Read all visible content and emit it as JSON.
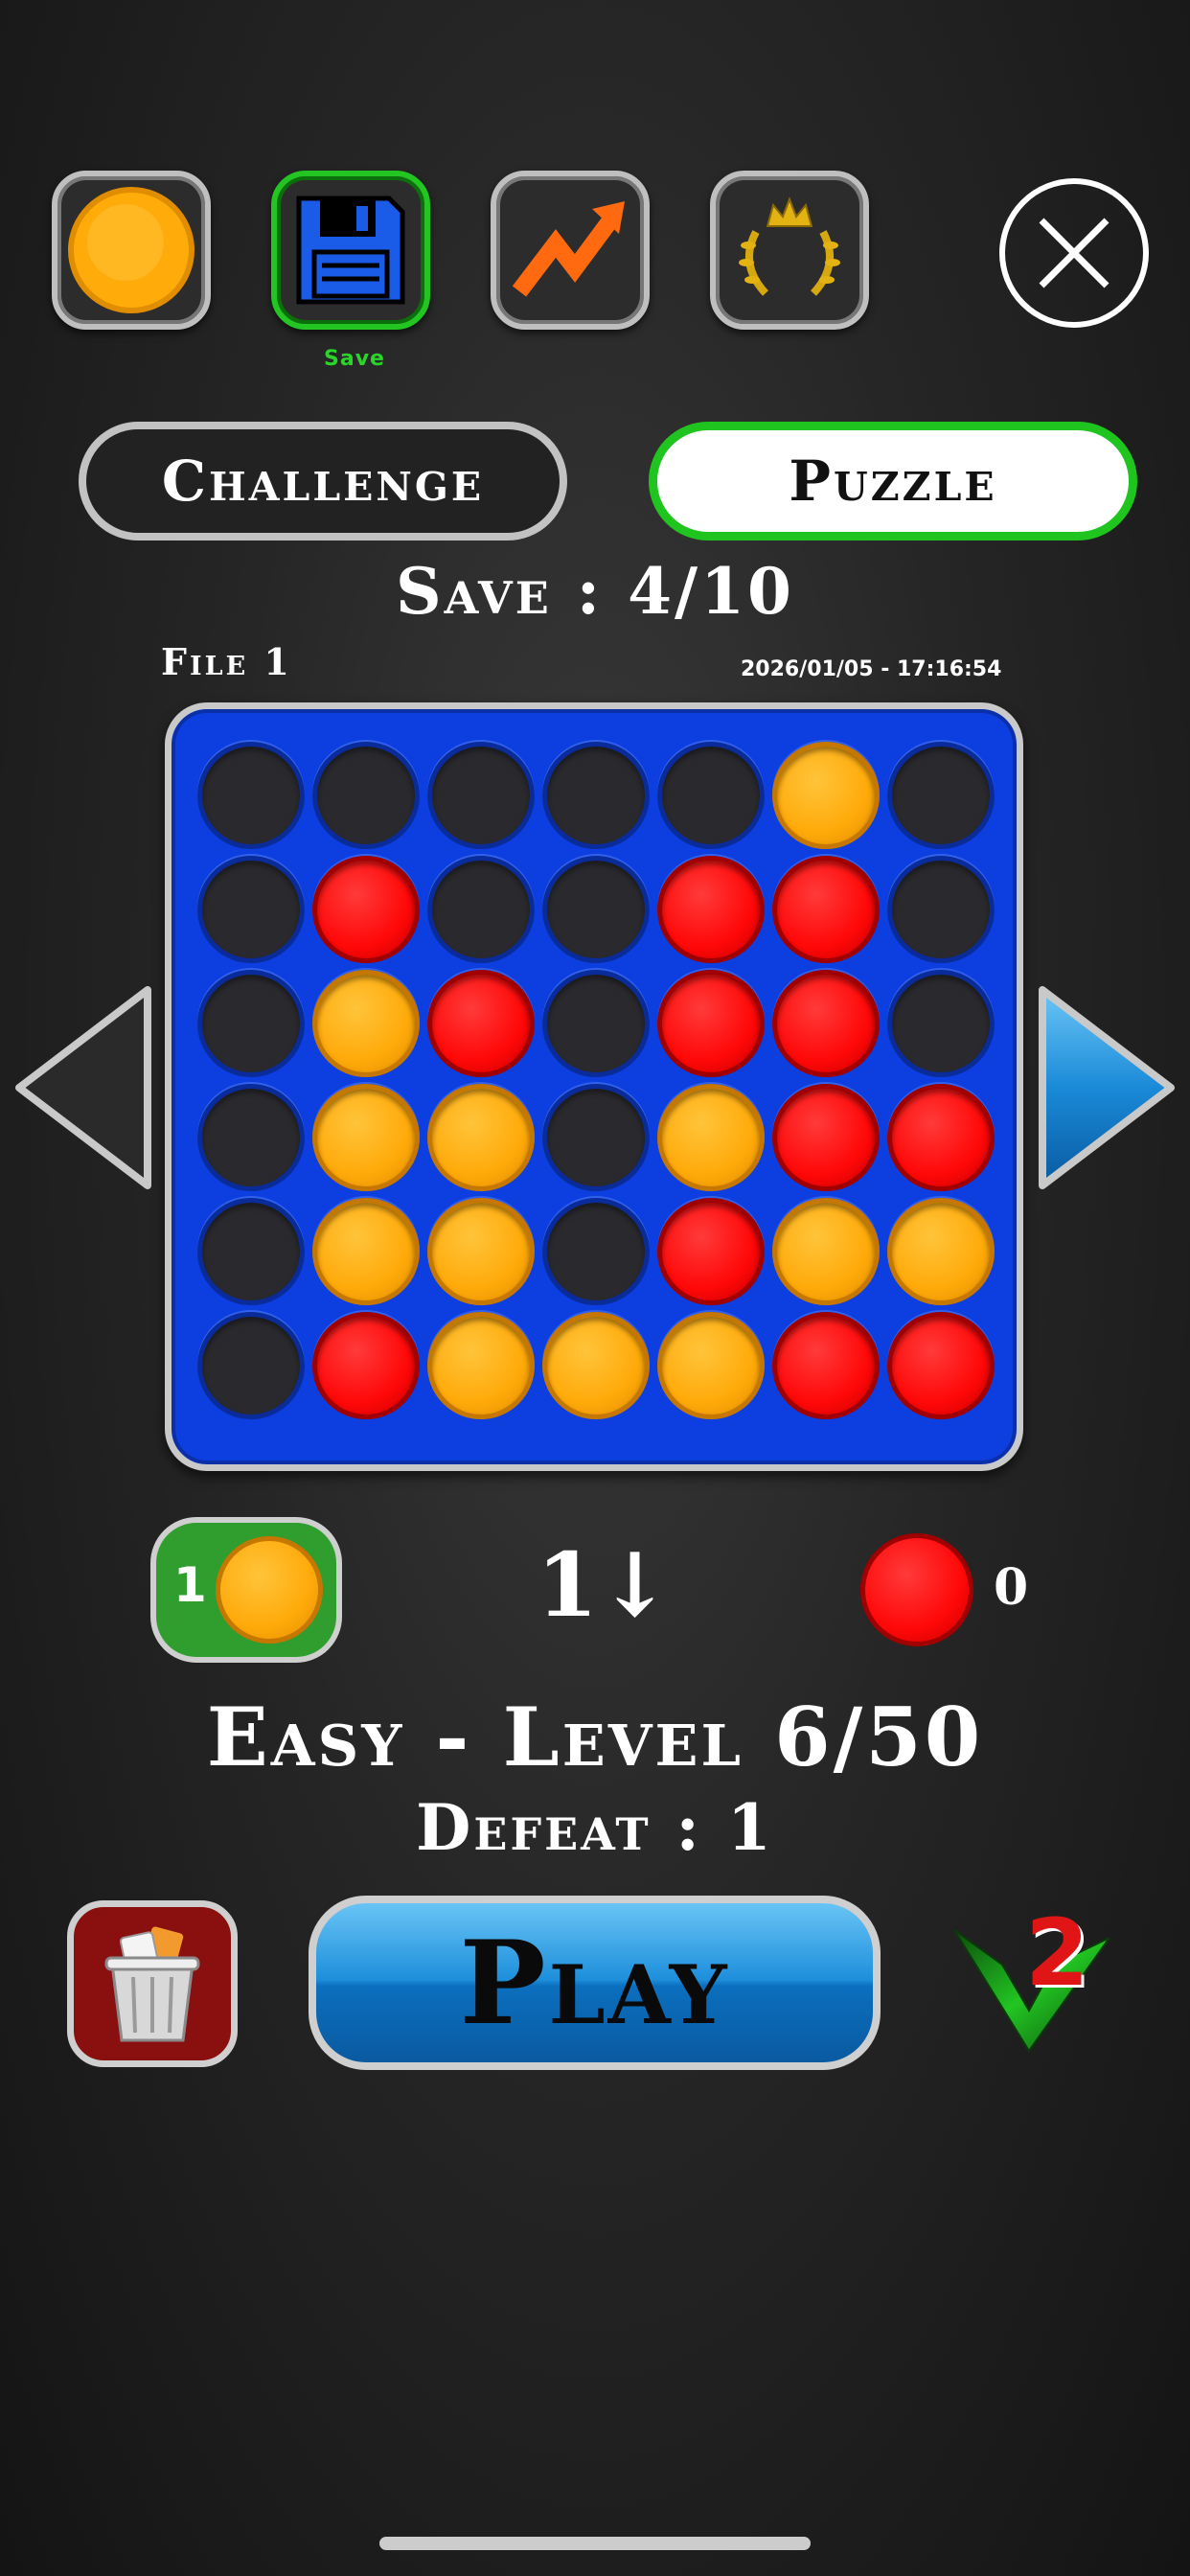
{
  "toolbar": {
    "save_label": "Save",
    "icons": [
      "coin-icon",
      "floppy-disk-icon",
      "trend-up-icon",
      "laurel-crown-icon",
      "close-icon"
    ]
  },
  "tabs": {
    "challenge": "Challenge",
    "puzzle": "Puzzle",
    "selected": "Puzzle"
  },
  "save_count": "Save : 4/10",
  "file": {
    "label": "File 1",
    "date": "2026/01/05 - 17:16:54"
  },
  "board": {
    "rows": [
      [
        "",
        "",
        "",
        "",
        "",
        "Y",
        ""
      ],
      [
        "",
        "R",
        "",
        "",
        "R",
        "R",
        ""
      ],
      [
        "",
        "Y",
        "R",
        "",
        "R",
        "R",
        ""
      ],
      [
        "",
        "Y",
        "Y",
        "",
        "Y",
        "R",
        "R"
      ],
      [
        "",
        "Y",
        "Y",
        "",
        "R",
        "Y",
        "Y"
      ],
      [
        "",
        "R",
        "Y",
        "Y",
        "Y",
        "R",
        "R"
      ]
    ]
  },
  "players": {
    "p1_number": "1",
    "moves": "1↓",
    "p2_score": "0"
  },
  "level": "Easy - Level 6/50",
  "defeat": "Defeat : 1",
  "play_label": "Play",
  "v2_badge": "2",
  "colors": {
    "yellow": "#ffaa0a",
    "red": "#ff0808",
    "board": "#0d3fe0",
    "accent_green": "#22c522",
    "play_blue": "#1e8fdc"
  }
}
